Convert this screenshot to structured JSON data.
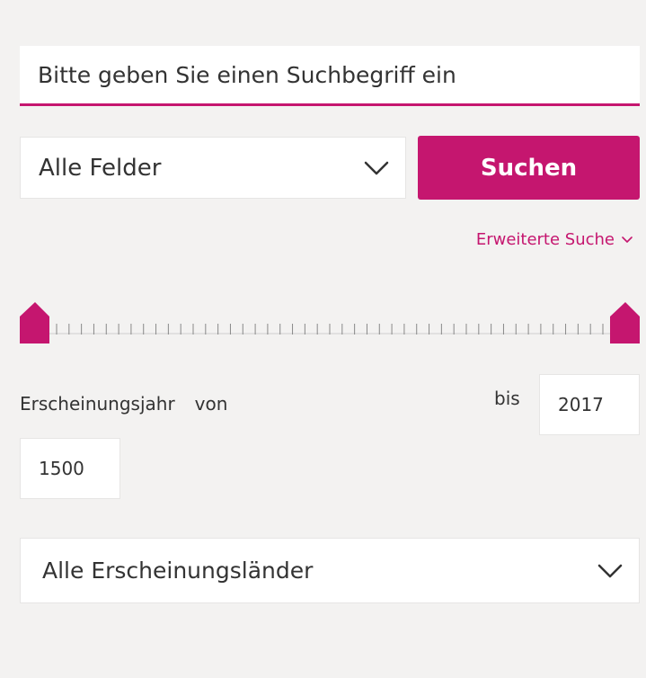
{
  "search": {
    "placeholder": "Bitte geben Sie einen Suchbegriff ein",
    "value": ""
  },
  "field_select": {
    "selected": "Alle Felder"
  },
  "submit": {
    "label": "Suchen"
  },
  "advanced_search": {
    "label": "Erweiterte Suche"
  },
  "year_filter": {
    "label": "Erscheinungsjahr",
    "from_label": "von",
    "to_label": "bis",
    "from_value": "1500",
    "to_value": "2017"
  },
  "country_select": {
    "selected": "Alle Erscheinungsländer"
  },
  "colors": {
    "accent": "#c5166f",
    "background": "#f3f2f1",
    "field_bg": "#ffffff",
    "text": "#333333"
  },
  "icons": [
    "chevron-down-icon",
    "slider-handle-icon"
  ]
}
